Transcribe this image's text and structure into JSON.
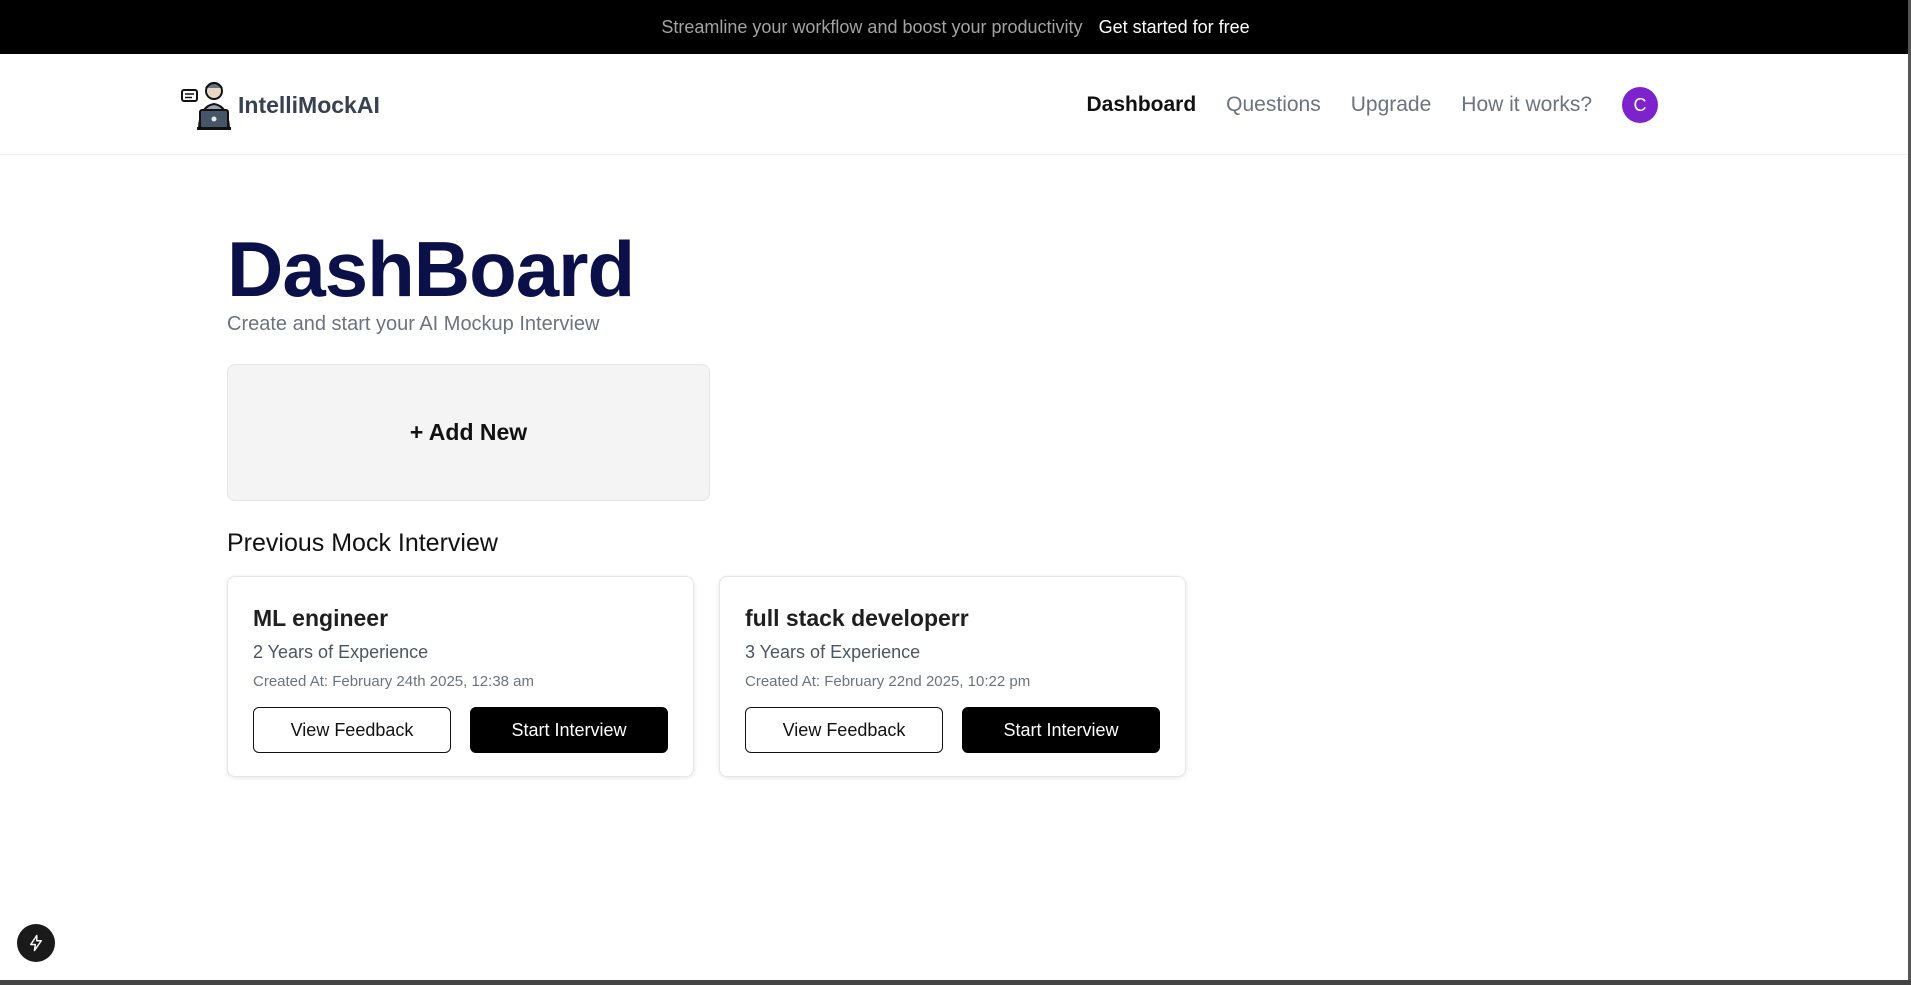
{
  "banner": {
    "message": "Streamline your workflow and boost your productivity",
    "cta": "Get started for free"
  },
  "header": {
    "brand": "IntelliMockAI",
    "logo_icon": "interviewer-laptop-icon",
    "nav": [
      {
        "label": "Dashboard",
        "active": true
      },
      {
        "label": "Questions",
        "active": false
      },
      {
        "label": "Upgrade",
        "active": false
      },
      {
        "label": "How it works?",
        "active": false
      }
    ],
    "avatar_initial": "C",
    "avatar_color": "#7e22ce"
  },
  "main": {
    "title": "DashBoard",
    "subtitle": "Create and start your AI Mockup Interview",
    "add_new_label": "+ Add New",
    "section_title": "Previous Mock Interview",
    "title_color": "#0b1148"
  },
  "interviews": [
    {
      "role": "ML engineer",
      "experience": "2 Years of Experience",
      "created": "Created At: February 24th 2025, 12:38 am",
      "feedback_label": "View Feedback",
      "start_label": "Start Interview"
    },
    {
      "role": "full stack developerr",
      "experience": "3 Years of Experience",
      "created": "Created At: February 22nd 2025, 10:22 pm",
      "feedback_label": "View Feedback",
      "start_label": "Start Interview"
    }
  ],
  "floating_button": {
    "icon": "lightning-bolt-icon"
  }
}
